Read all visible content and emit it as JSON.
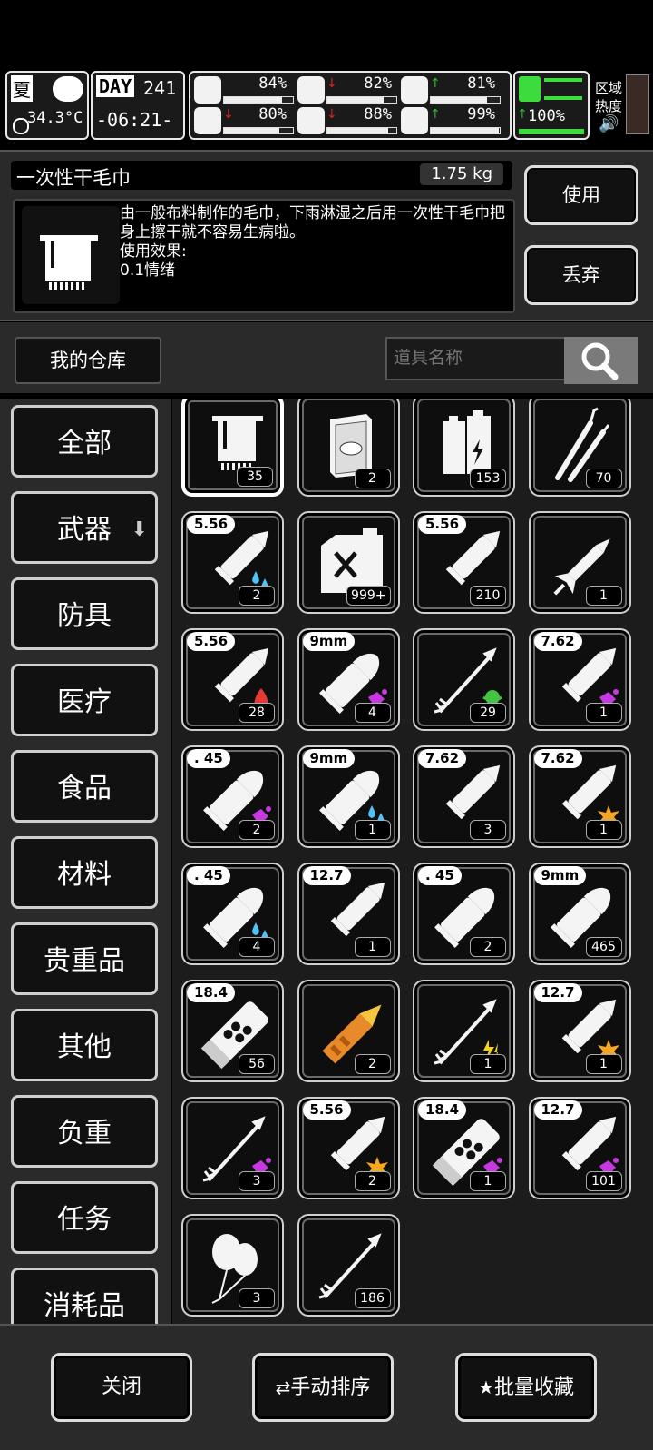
{
  "hud": {
    "season": "夏",
    "temperature": "34.3°C",
    "day_label": "DAY",
    "day_number": "241",
    "time": "-06:21-",
    "stats": [
      {
        "name": "health",
        "value": "84%",
        "trend": "",
        "fill": 0.84
      },
      {
        "name": "hunger",
        "value": "82%",
        "trend": "down",
        "fill": 0.82
      },
      {
        "name": "energy",
        "value": "81%",
        "trend": "up",
        "fill": 0.81
      },
      {
        "name": "sanity",
        "value": "80%",
        "trend": "down",
        "fill": 0.8
      },
      {
        "name": "thirst",
        "value": "88%",
        "trend": "down",
        "fill": 0.88
      },
      {
        "name": "mood",
        "value": "99%",
        "trend": "up",
        "fill": 0.99
      }
    ],
    "stamina": "100%",
    "stamina_trend": "up",
    "region_heat_line1": "区域",
    "region_heat_line2": "热度"
  },
  "detail": {
    "item_name": "一次性干毛巾",
    "weight": "1.75 kg",
    "description": "由一般布料制作的毛巾，下雨淋湿之后用一次性干毛巾把身上擦干就不容易生病啦。\n使用效果:\n0.1情绪",
    "use_label": "使用",
    "discard_label": "丢弃"
  },
  "warehouse": {
    "label": "我的仓库",
    "search_placeholder": "道具名称"
  },
  "categories": [
    "全部",
    "武器",
    "防具",
    "医疗",
    "食品",
    "材料",
    "贵重品",
    "其他",
    "负重",
    "任务",
    "消耗品"
  ],
  "items": [
    {
      "icon": "towel",
      "caliber": "",
      "count": "35",
      "selected": true
    },
    {
      "icon": "book",
      "caliber": "",
      "count": "2"
    },
    {
      "icon": "battery",
      "caliber": "",
      "count": "153"
    },
    {
      "icon": "lockpick",
      "caliber": "",
      "count": "70"
    },
    {
      "icon": "rifle-bullet",
      "caliber": "5.56",
      "count": "2",
      "effect": "water"
    },
    {
      "icon": "fuel-can",
      "caliber": "",
      "count": "999+"
    },
    {
      "icon": "rifle-bullet",
      "caliber": "5.56",
      "count": "210"
    },
    {
      "icon": "rocket",
      "caliber": "",
      "count": "1"
    },
    {
      "icon": "rifle-bullet",
      "caliber": "5.56",
      "count": "28",
      "effect": "fire"
    },
    {
      "icon": "pistol-bullet",
      "caliber": "9mm",
      "count": "4",
      "effect": "purple"
    },
    {
      "icon": "arrow",
      "caliber": "",
      "count": "29",
      "effect": "poison"
    },
    {
      "icon": "rifle-bullet",
      "caliber": "7.62",
      "count": "1",
      "effect": "purple"
    },
    {
      "icon": "pistol-bullet",
      "caliber": ". 45",
      "count": "2",
      "effect": "purple"
    },
    {
      "icon": "pistol-bullet",
      "caliber": "9mm",
      "count": "1",
      "effect": "water"
    },
    {
      "icon": "rifle-bullet",
      "caliber": "7.62",
      "count": "3"
    },
    {
      "icon": "rifle-bullet",
      "caliber": "7.62",
      "count": "1",
      "effect": "blast"
    },
    {
      "icon": "pistol-bullet",
      "caliber": ". 45",
      "count": "4",
      "effect": "water"
    },
    {
      "icon": "rifle-bullet",
      "caliber": "12.7",
      "count": "1"
    },
    {
      "icon": "pistol-bullet",
      "caliber": ". 45",
      "count": "2"
    },
    {
      "icon": "pistol-bullet",
      "caliber": "9mm",
      "count": "465"
    },
    {
      "icon": "shotgun-shell",
      "caliber": "18.4",
      "count": "56"
    },
    {
      "icon": "golden-rocket",
      "caliber": "",
      "count": "2"
    },
    {
      "icon": "arrow",
      "caliber": "",
      "count": "1",
      "effect": "electric"
    },
    {
      "icon": "rifle-bullet",
      "caliber": "12.7",
      "count": "1",
      "effect": "blast"
    },
    {
      "icon": "arrow",
      "caliber": "",
      "count": "3",
      "effect": "purple"
    },
    {
      "icon": "rifle-bullet",
      "caliber": "5.56",
      "count": "2",
      "effect": "blast"
    },
    {
      "icon": "shotgun-shell",
      "caliber": "18.4",
      "count": "1",
      "effect": "purple"
    },
    {
      "icon": "rifle-bullet",
      "caliber": "12.7",
      "count": "101",
      "effect": "purple"
    },
    {
      "icon": "balloons",
      "caliber": "",
      "count": "3"
    },
    {
      "icon": "arrow",
      "caliber": "",
      "count": "186"
    }
  ],
  "bottom": {
    "close_label": "关闭",
    "sort_label": "手动排序",
    "favorite_label": "批量收藏"
  },
  "colors": {
    "background": "#000000",
    "panel": "#2a2a2a",
    "up_arrow": "#25c225",
    "down_arrow": "#e02020",
    "water": "#4fc3f7",
    "fire": "#e53935",
    "poison": "#43c443",
    "purple": "#c838e0",
    "blast": "#f5a623",
    "electric": "#f5d020"
  }
}
